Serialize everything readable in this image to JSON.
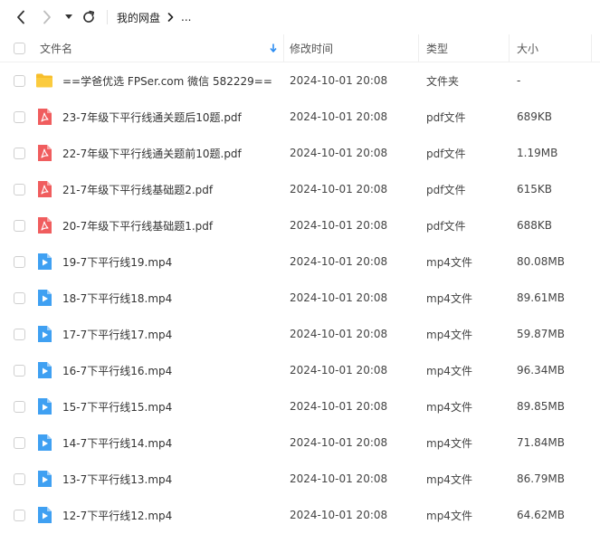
{
  "breadcrumb": {
    "root": "我的网盘",
    "more": "..."
  },
  "columns": {
    "name": "文件名",
    "modified": "修改时间",
    "type": "类型",
    "size": "大小"
  },
  "colors": {
    "folder": "#F7BE2B",
    "pdf": "#F05D5E",
    "video": "#3FA0F2",
    "sort_arrow": "#2B8CF2"
  },
  "files": [
    {
      "icon": "folder-icon",
      "name": "==学爸优选 FPSer.com 微信 582229==",
      "modified": "2024-10-01 20:08",
      "type": "文件夹",
      "size": "-"
    },
    {
      "icon": "pdf-file-icon",
      "name": "23-7年级下平行线通关题后10题.pdf",
      "modified": "2024-10-01 20:08",
      "type": "pdf文件",
      "size": "689KB"
    },
    {
      "icon": "pdf-file-icon",
      "name": "22-7年级下平行线通关题前10题.pdf",
      "modified": "2024-10-01 20:08",
      "type": "pdf文件",
      "size": "1.19MB"
    },
    {
      "icon": "pdf-file-icon",
      "name": "21-7年级下平行线基础题2.pdf",
      "modified": "2024-10-01 20:08",
      "type": "pdf文件",
      "size": "615KB"
    },
    {
      "icon": "pdf-file-icon",
      "name": "20-7年级下平行线基础题1.pdf",
      "modified": "2024-10-01 20:08",
      "type": "pdf文件",
      "size": "688KB"
    },
    {
      "icon": "video-file-icon",
      "name": "19-7下平行线19.mp4",
      "modified": "2024-10-01 20:08",
      "type": "mp4文件",
      "size": "80.08MB"
    },
    {
      "icon": "video-file-icon",
      "name": "18-7下平行线18.mp4",
      "modified": "2024-10-01 20:08",
      "type": "mp4文件",
      "size": "89.61MB"
    },
    {
      "icon": "video-file-icon",
      "name": "17-7下平行线17.mp4",
      "modified": "2024-10-01 20:08",
      "type": "mp4文件",
      "size": "59.87MB"
    },
    {
      "icon": "video-file-icon",
      "name": "16-7下平行线16.mp4",
      "modified": "2024-10-01 20:08",
      "type": "mp4文件",
      "size": "96.34MB"
    },
    {
      "icon": "video-file-icon",
      "name": "15-7下平行线15.mp4",
      "modified": "2024-10-01 20:08",
      "type": "mp4文件",
      "size": "89.85MB"
    },
    {
      "icon": "video-file-icon",
      "name": "14-7下平行线14.mp4",
      "modified": "2024-10-01 20:08",
      "type": "mp4文件",
      "size": "71.84MB"
    },
    {
      "icon": "video-file-icon",
      "name": "13-7下平行线13.mp4",
      "modified": "2024-10-01 20:08",
      "type": "mp4文件",
      "size": "86.79MB"
    },
    {
      "icon": "video-file-icon",
      "name": "12-7下平行线12.mp4",
      "modified": "2024-10-01 20:08",
      "type": "mp4文件",
      "size": "64.62MB"
    }
  ]
}
